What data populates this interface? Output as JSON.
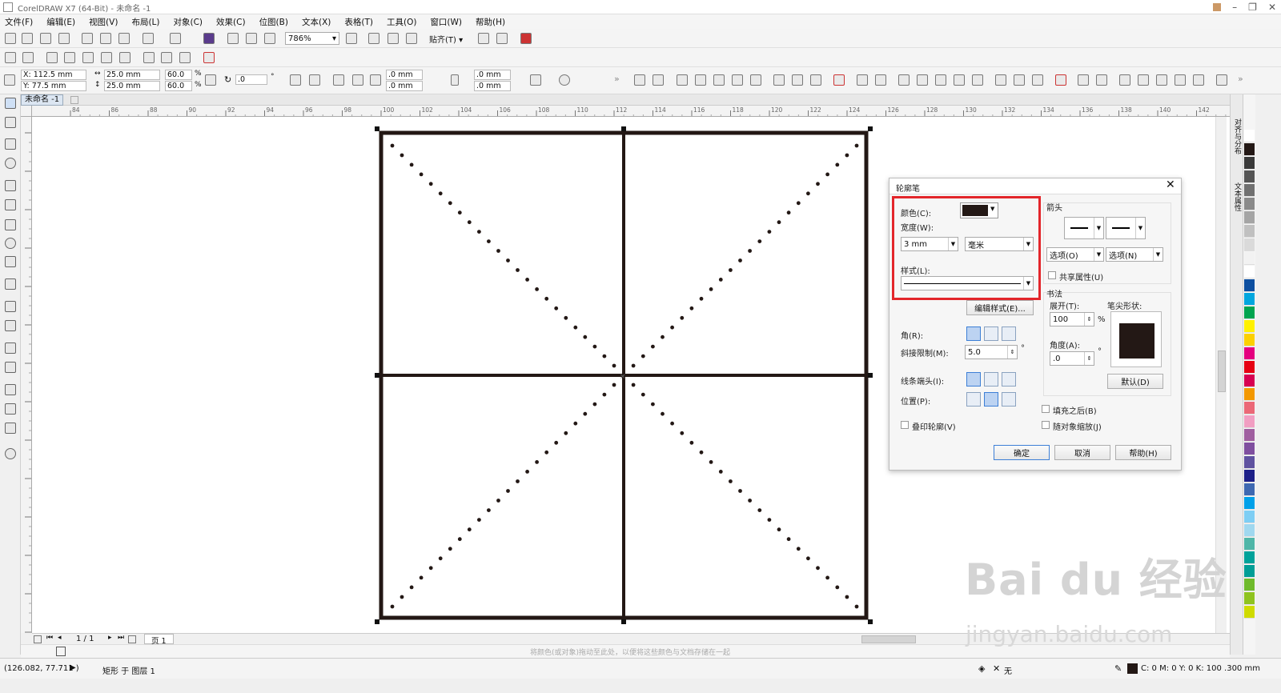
{
  "window": {
    "title": "CorelDRAW X7 (64-Bit) - 未命名 -1"
  },
  "menu": [
    "文件(F)",
    "编辑(E)",
    "视图(V)",
    "布局(L)",
    "对象(C)",
    "效果(C)",
    "位图(B)",
    "文本(X)",
    "表格(T)",
    "工具(O)",
    "窗口(W)",
    "帮助(H)"
  ],
  "toolbar": {
    "zoom": "786%",
    "snap": "贴齐(T)"
  },
  "propbar": {
    "x": "X: 112.5 mm",
    "y": "Y: 77.5 mm",
    "w": "25.0 mm",
    "h": "25.0 mm",
    "sx": "60.0",
    "sy": "60.0",
    "pct": "%",
    "rot": ".0",
    "deg": "°",
    "r1": ".0 mm",
    "r2": ".0 mm",
    "r3": ".0 mm",
    "r4": ".0 mm"
  },
  "doc": {
    "tab": "未命名 -1"
  },
  "ruler": {
    "h": [
      "84",
      "86",
      "88",
      "90",
      "92",
      "94",
      "96",
      "98",
      "100",
      "102",
      "104",
      "106",
      "108",
      "110",
      "112",
      "114",
      "116",
      "118",
      "120",
      "122",
      "124",
      "126",
      "128",
      "130",
      "132",
      "134",
      "136",
      "138",
      "140",
      "142"
    ]
  },
  "pager": {
    "count": "1 / 1",
    "page": "页 1"
  },
  "status": {
    "coords": "(126.082, 77.711 )",
    "object": "矩形 于 图层 1",
    "hint": "将颜色(或对象)拖动至此处，以便将这些颜色与文档存储在一起",
    "fill": "无",
    "outline": "C: 0 M: 0 Y: 0 K: 100  .300 mm"
  },
  "dialog": {
    "title": "轮廓笔",
    "color_label": "颜色(C):",
    "width_label": "宽度(W):",
    "width_value": "3 mm",
    "unit": "毫米",
    "style_label": "样式(L):",
    "edit_style": "编辑样式(E)...",
    "corner_label": "角(R):",
    "miter_label": "斜接限制(M):",
    "miter_value": "5.0",
    "degree": "°",
    "cap_label": "线条端头(I):",
    "pos_label": "位置(P):",
    "overprint": "叠印轮廓(V)",
    "arrow_label": "箭头",
    "opt1": "选项(O)",
    "opt2": "选项(N)",
    "share": "共享属性(U)",
    "calli_label": "书法",
    "spread_label": "展开(T):",
    "spread_value": "100",
    "pct": "%",
    "nib_label": "笔尖形状:",
    "angle_label": "角度(A):",
    "angle_value": ".0",
    "default_btn": "默认(D)",
    "behind_fill": "填充之后(B)",
    "scale_with": "随对象缩放(J)",
    "ok": "确定",
    "cancel": "取消",
    "help": "帮助(H)"
  },
  "side": {
    "tab1": "对齐与分布",
    "tab2": "文本属性"
  },
  "watermark": {
    "line1": "Bai du 经验",
    "line2": "jingyan.baidu.com"
  },
  "colors": {
    "outline": "#231815",
    "accent": "#3d7fd6",
    "highlight": "#e3262b"
  }
}
